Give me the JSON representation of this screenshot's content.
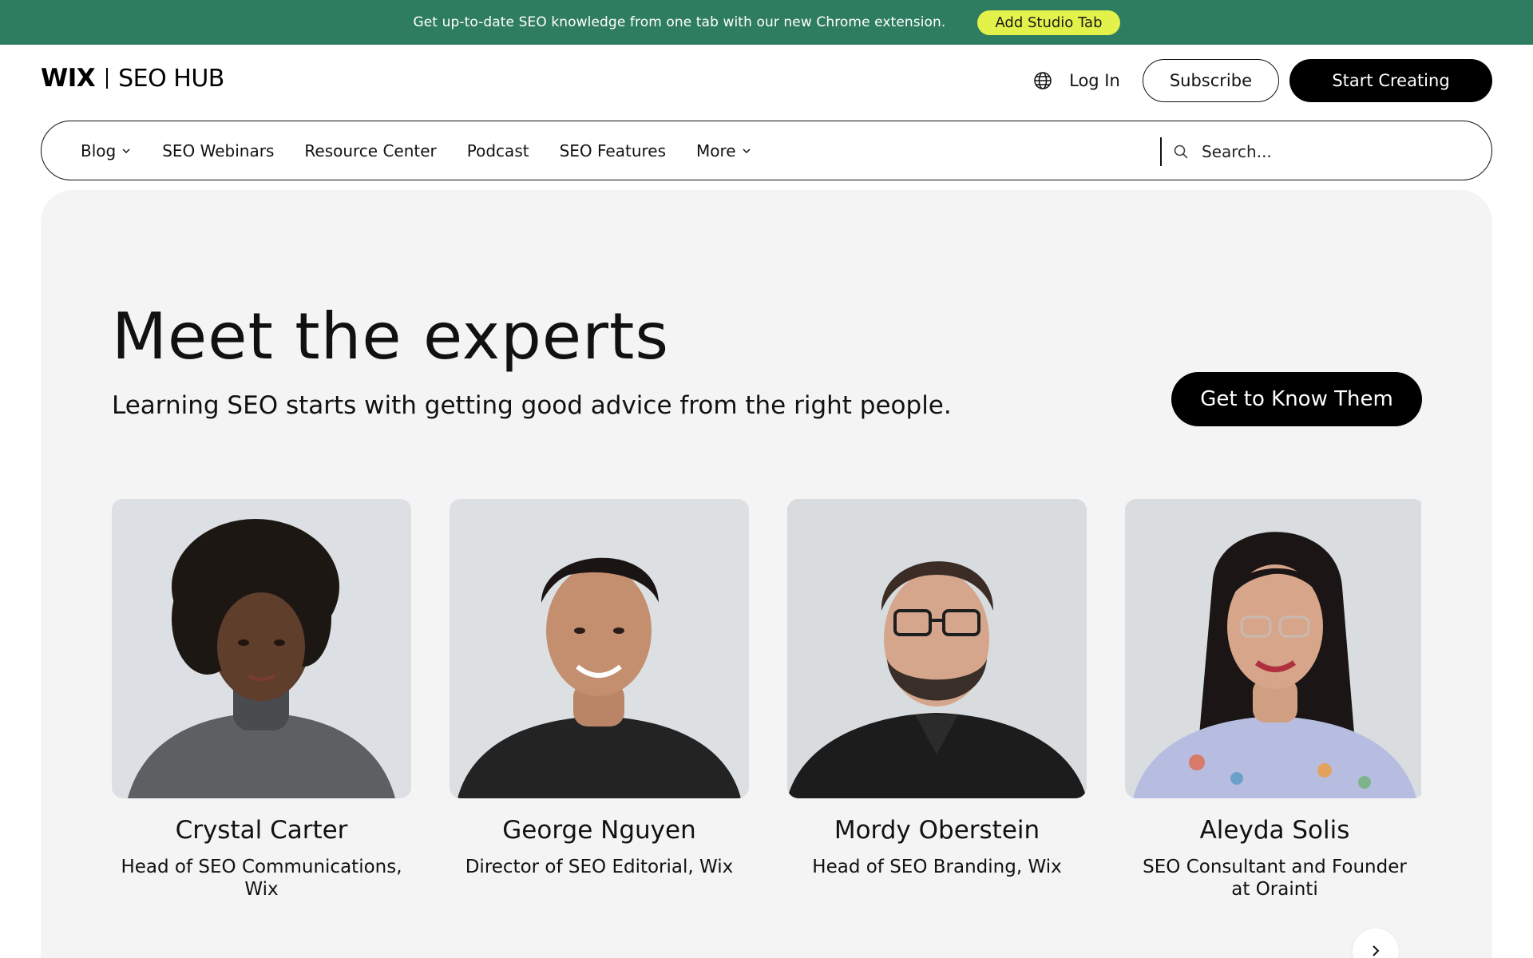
{
  "banner": {
    "text": "Get up-to-date SEO knowledge from one tab with our new Chrome extension.",
    "button_label": "Add Studio Tab",
    "bg_color": "#2f7d60",
    "button_color": "#e3f24a"
  },
  "header": {
    "logo_brand": "WIX",
    "logo_product": "SEO HUB",
    "globe_icon": "globe-icon",
    "login_label": "Log In",
    "subscribe_label": "Subscribe",
    "start_label": "Start Creating"
  },
  "nav": {
    "items": [
      {
        "label": "Blog",
        "has_dropdown": true
      },
      {
        "label": "SEO Webinars",
        "has_dropdown": false
      },
      {
        "label": "Resource Center",
        "has_dropdown": false
      },
      {
        "label": "Podcast",
        "has_dropdown": false
      },
      {
        "label": "SEO Features",
        "has_dropdown": false
      },
      {
        "label": "More",
        "has_dropdown": true
      }
    ],
    "search_placeholder": "Search..."
  },
  "hero": {
    "title": "Meet the experts",
    "subtitle": "Learning SEO starts with getting good advice from the right people.",
    "cta_label": "Get to Know Them"
  },
  "experts": [
    {
      "name": "Crystal Carter",
      "role": "Head of SEO Communications, Wix"
    },
    {
      "name": "George Nguyen",
      "role": "Director of SEO Editorial, Wix"
    },
    {
      "name": "Mordy Oberstein",
      "role": "Head of SEO Branding, Wix"
    },
    {
      "name": "Aleyda Solis",
      "role": "SEO Consultant and Founder at Orainti"
    }
  ],
  "carousel": {
    "next_icon": "chevron-right-icon"
  }
}
